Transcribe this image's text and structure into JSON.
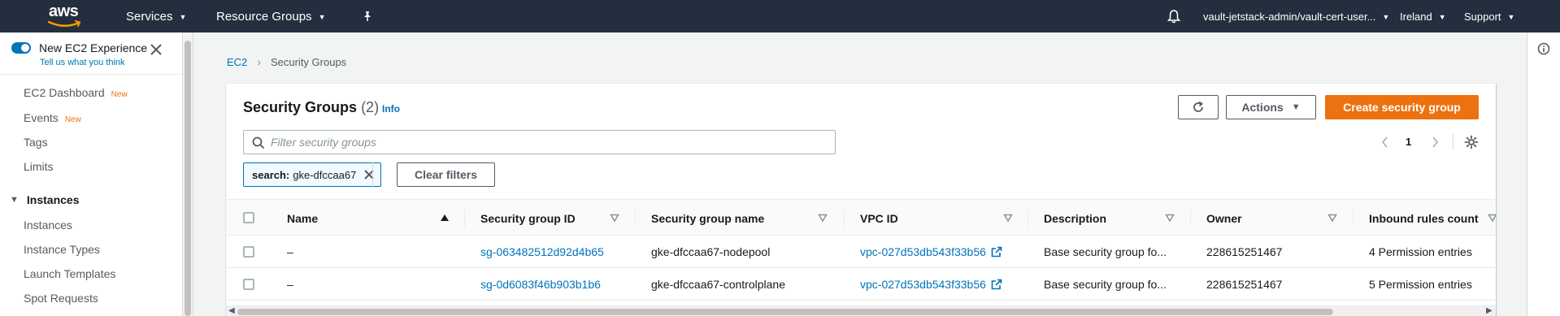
{
  "nav": {
    "logo_text": "aws",
    "services": "Services",
    "resource_groups": "Resource Groups",
    "account": "vault-jetstack-admin/vault-cert-user...",
    "region": "Ireland",
    "support": "Support"
  },
  "sidebar": {
    "new_experience": "New EC2 Experience",
    "tell_us": "Tell us what you think",
    "items": [
      {
        "label": "EC2 Dashboard",
        "badge": "New"
      },
      {
        "label": "Events",
        "badge": "New"
      },
      {
        "label": "Tags",
        "badge": ""
      },
      {
        "label": "Limits",
        "badge": ""
      }
    ],
    "section_instances": "Instances",
    "instances_items": [
      {
        "label": "Instances"
      },
      {
        "label": "Instance Types"
      },
      {
        "label": "Launch Templates"
      },
      {
        "label": "Spot Requests"
      }
    ]
  },
  "breadcrumb": {
    "root": "EC2",
    "current": "Security Groups"
  },
  "panel": {
    "title": "Security Groups",
    "count": "(2)",
    "info": "Info",
    "actions": "Actions",
    "create": "Create security group",
    "search_placeholder": "Filter security groups",
    "page": "1",
    "filter_token_key": "search:",
    "filter_token_value": "gke-dfccaa67",
    "clear_filters": "Clear filters"
  },
  "table": {
    "columns": [
      "Name",
      "Security group ID",
      "Security group name",
      "VPC ID",
      "Description",
      "Owner",
      "Inbound rules count"
    ],
    "rows": [
      {
        "name": "–",
        "sg_id": "sg-063482512d92d4b65",
        "sg_name": "gke-dfccaa67-nodepool",
        "vpc_id": "vpc-027d53db543f33b56",
        "description": "Base security group fo...",
        "owner": "228615251467",
        "inbound": "4 Permission entries"
      },
      {
        "name": "–",
        "sg_id": "sg-0d6083f46b903b1b6",
        "sg_name": "gke-dfccaa67-controlplane",
        "vpc_id": "vpc-027d53db543f33b56",
        "description": "Base security group fo...",
        "owner": "228615251467",
        "inbound": "5 Permission entries"
      }
    ]
  },
  "colors": {
    "nav_bg": "#232f3e",
    "link": "#0073bb",
    "primary": "#ec7211",
    "badge_new": "#ec7211"
  },
  "icons": {
    "bell": "bell-icon",
    "pin": "pin-icon",
    "refresh": "refresh-icon",
    "settings": "gear-icon",
    "search": "search-icon",
    "external": "external-link-icon",
    "info": "info-icon"
  }
}
